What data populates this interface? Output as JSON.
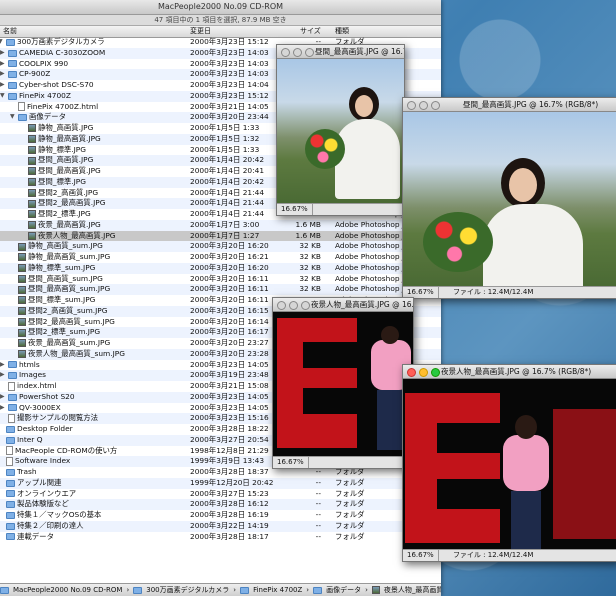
{
  "finder": {
    "title": "MacPeople2000 No.09 CD-ROM",
    "status": "47 項目中の 1 項目を選択, 87.9 MB 空き",
    "columns": {
      "name": "名前",
      "date": "変更日",
      "size": "サイズ",
      "kind": "種類"
    },
    "rows": [
      {
        "indent": 0,
        "icon": "folder",
        "tri": "▼",
        "name": "300万画素デジタルカメラ",
        "date": "2000年3月23日 15:12",
        "size": "--",
        "kind": "フォルダ"
      },
      {
        "indent": 1,
        "icon": "folder",
        "tri": "▶",
        "name": "CAMEDIA C-3030ZOOM",
        "date": "2000年3月23日 14:03",
        "size": "--",
        "kind": "フォルダ"
      },
      {
        "indent": 1,
        "icon": "folder",
        "tri": "▶",
        "name": "COOLPIX 990",
        "date": "2000年3月23日 14:03",
        "size": "--",
        "kind": "フォルダ"
      },
      {
        "indent": 1,
        "icon": "folder",
        "tri": "▶",
        "name": "CP-900Z",
        "date": "2000年3月23日 14:03",
        "size": "--",
        "kind": "フォルダ"
      },
      {
        "indent": 1,
        "icon": "folder",
        "tri": "▶",
        "name": "Cyber-shot DSC-S70",
        "date": "2000年3月23日 14:04",
        "size": "--",
        "kind": "フォルダ"
      },
      {
        "indent": 1,
        "icon": "folder",
        "tri": "▼",
        "name": "FinePix 4700Z",
        "date": "2000年3月23日 15:12",
        "size": "--",
        "kind": "フォルダ"
      },
      {
        "indent": 2,
        "icon": "file",
        "tri": "",
        "name": "FinePix 4700Z.html",
        "date": "2000年3月21日 14:05",
        "size": "",
        "kind": ""
      },
      {
        "indent": 2,
        "icon": "folder",
        "tri": "▼",
        "name": "画像データ",
        "date": "2000年3月20日 23:44",
        "size": "",
        "kind": ""
      },
      {
        "indent": 3,
        "icon": "image",
        "tri": "",
        "name": "静物_高画質.JPG",
        "date": "2000年1月5日 1:33",
        "size": "",
        "kind": ""
      },
      {
        "indent": 3,
        "icon": "image",
        "tri": "",
        "name": "静物_最高画質.JPG",
        "date": "2000年1月5日 1:32",
        "size": "",
        "kind": ""
      },
      {
        "indent": 3,
        "icon": "image",
        "tri": "",
        "name": "静物_標準.JPG",
        "date": "2000年1月5日 1:33",
        "size": "",
        "kind": ""
      },
      {
        "indent": 3,
        "icon": "image",
        "tri": "",
        "name": "昼間_高画質.JPG",
        "date": "2000年1月4日 20:42",
        "size": "",
        "kind": ""
      },
      {
        "indent": 3,
        "icon": "image",
        "tri": "",
        "name": "昼間_最高画質.JPG",
        "date": "2000年1月4日 20:41",
        "size": "",
        "kind": ""
      },
      {
        "indent": 3,
        "icon": "image",
        "tri": "",
        "name": "昼間_標準.JPG",
        "date": "2000年1月4日 20:42",
        "size": "",
        "kind": ""
      },
      {
        "indent": 3,
        "icon": "image",
        "tri": "",
        "name": "昼間2_高画質.JPG",
        "date": "2000年1月4日 21:44",
        "size": "",
        "kind": ""
      },
      {
        "indent": 3,
        "icon": "image",
        "tri": "",
        "name": "昼間2_最高画質.JPG",
        "date": "2000年1月4日 21:44",
        "size": "",
        "kind": ""
      },
      {
        "indent": 3,
        "icon": "image",
        "tri": "",
        "name": "昼間2_標準.JPG",
        "date": "2000年1月4日 21:44",
        "size": "355 KB",
        "kind": "Adobe Photoshop JPG"
      },
      {
        "indent": 3,
        "icon": "image",
        "tri": "",
        "name": "夜景_最高画質.JPG",
        "date": "2000年1月7日 3:00",
        "size": "1.6 MB",
        "kind": "Adobe Photoshop JPG"
      },
      {
        "indent": 3,
        "icon": "image",
        "tri": "",
        "name": "夜景人物_最高画質.JPG",
        "date": "2000年1月7日 1:27",
        "size": "1.6 MB",
        "kind": "Adobe Photoshop JPG",
        "selected": true
      },
      {
        "indent": 2,
        "icon": "image",
        "tri": "",
        "name": "静物_高画質_sum.JPG",
        "date": "2000年3月20日 16:20",
        "size": "32 KB",
        "kind": "Adobe Photoshop JPG"
      },
      {
        "indent": 2,
        "icon": "image",
        "tri": "",
        "name": "静物_最高画質_sum.JPG",
        "date": "2000年3月20日 16:21",
        "size": "32 KB",
        "kind": "Adobe Photoshop JPG"
      },
      {
        "indent": 2,
        "icon": "image",
        "tri": "",
        "name": "静物_標準_sum.JPG",
        "date": "2000年3月20日 16:20",
        "size": "32 KB",
        "kind": "Adobe Photoshop JPG"
      },
      {
        "indent": 2,
        "icon": "image",
        "tri": "",
        "name": "昼間_高画質_sum.JPG",
        "date": "2000年3月20日 16:11",
        "size": "32 KB",
        "kind": "Adobe Photoshop JPG"
      },
      {
        "indent": 2,
        "icon": "image",
        "tri": "",
        "name": "昼間_最高画質_sum.JPG",
        "date": "2000年3月20日 16:11",
        "size": "32 KB",
        "kind": "Adobe Photoshop JPG"
      },
      {
        "indent": 2,
        "icon": "image",
        "tri": "",
        "name": "昼間_標準_sum.JPG",
        "date": "2000年3月20日 16:11",
        "size": "32 KB",
        "kind": "Adobe Photoshop JPG"
      },
      {
        "indent": 2,
        "icon": "image",
        "tri": "",
        "name": "昼間2_高画質_sum.JPG",
        "date": "2000年3月20日 16:15",
        "size": "",
        "kind": ""
      },
      {
        "indent": 2,
        "icon": "image",
        "tri": "",
        "name": "昼間2_最高画質_sum.JPG",
        "date": "2000年3月20日 16:14",
        "size": "",
        "kind": ""
      },
      {
        "indent": 2,
        "icon": "image",
        "tri": "",
        "name": "昼間2_標準_sum.JPG",
        "date": "2000年3月20日 16:17",
        "size": "",
        "kind": ""
      },
      {
        "indent": 2,
        "icon": "image",
        "tri": "",
        "name": "夜景_最高画質_sum.JPG",
        "date": "2000年3月20日 23:27",
        "size": "",
        "kind": ""
      },
      {
        "indent": 2,
        "icon": "image",
        "tri": "",
        "name": "夜景人物_最高画質_sum.JPG",
        "date": "2000年3月20日 23:28",
        "size": "",
        "kind": ""
      },
      {
        "indent": 1,
        "icon": "folder",
        "tri": "▶",
        "name": "htmls",
        "date": "2000年3月23日 14:05",
        "size": "",
        "kind": ""
      },
      {
        "indent": 1,
        "icon": "folder",
        "tri": "▶",
        "name": "Images",
        "date": "2000年3月19日 23:48",
        "size": "",
        "kind": ""
      },
      {
        "indent": 1,
        "icon": "file",
        "tri": "",
        "name": "index.html",
        "date": "2000年3月21日 15:08",
        "size": "",
        "kind": ""
      },
      {
        "indent": 1,
        "icon": "folder",
        "tri": "▶",
        "name": "PowerShot S20",
        "date": "2000年3月23日 14:05",
        "size": "",
        "kind": ""
      },
      {
        "indent": 1,
        "icon": "folder",
        "tri": "▶",
        "name": "QV-3000EX",
        "date": "2000年3月23日 14:05",
        "size": "",
        "kind": ""
      },
      {
        "indent": 1,
        "icon": "file",
        "tri": "",
        "name": "撮影サンプルの閲覧方法",
        "date": "2000年3月23日 15:16",
        "size": "",
        "kind": ""
      },
      {
        "indent": 0,
        "icon": "folder",
        "tri": "",
        "name": "Desktop Folder",
        "date": "2000年3月28日 18:22",
        "size": "",
        "kind": ""
      },
      {
        "indent": 0,
        "icon": "folder",
        "tri": "",
        "name": "Inter Q",
        "date": "2000年3月27日 20:54",
        "size": "",
        "kind": ""
      },
      {
        "indent": 0,
        "icon": "file",
        "tri": "",
        "name": "MacPeople CD-ROMの使い方",
        "date": "1998年12月8日 21:29",
        "size": "",
        "kind": ""
      },
      {
        "indent": 0,
        "icon": "file",
        "tri": "",
        "name": "Software Index",
        "date": "1999年3月9日 13:43",
        "size": "",
        "kind": ""
      },
      {
        "indent": 0,
        "icon": "folder",
        "tri": "",
        "name": "Trash",
        "date": "2000年3月28日 18:37",
        "size": "--",
        "kind": "フォルダ"
      },
      {
        "indent": 0,
        "icon": "folder",
        "tri": "",
        "name": "アップル関連",
        "date": "1999年12月20日 20:42",
        "size": "--",
        "kind": "フォルダ"
      },
      {
        "indent": 0,
        "icon": "folder",
        "tri": "",
        "name": "オンラインウエア",
        "date": "2000年3月27日 15:23",
        "size": "--",
        "kind": "フォルダ"
      },
      {
        "indent": 0,
        "icon": "folder",
        "tri": "",
        "name": "製品体験版など",
        "date": "2000年3月28日 16:12",
        "size": "--",
        "kind": "フォルダ"
      },
      {
        "indent": 0,
        "icon": "folder",
        "tri": "",
        "name": "特集１／マックOSの基本",
        "date": "2000年3月28日 16:19",
        "size": "--",
        "kind": "フォルダ"
      },
      {
        "indent": 0,
        "icon": "folder",
        "tri": "",
        "name": "特集２／印刷の達人",
        "date": "2000年3月22日 14:19",
        "size": "--",
        "kind": "フォルダ"
      },
      {
        "indent": 0,
        "icon": "folder",
        "tri": "",
        "name": "連載データ",
        "date": "2000年3月28日 18:17",
        "size": "--",
        "kind": "フォルダ"
      }
    ],
    "path": [
      "MacPeople2000 No.09 CD-ROM",
      "300万画素デジタルカメラ",
      "FinePix 4700Z",
      "画像データ",
      "夜景人物_最高画質.JPG"
    ]
  },
  "windows": [
    {
      "title": "昼間_最高画質.JPG @ 16.7% (RGB/8*)",
      "zoom": "16.67%",
      "file": ""
    },
    {
      "title": "昼間_最高画質.JPG @ 16.7% (RGB/8*)",
      "zoom": "16.67%",
      "file": "ファイル : 12.4M/12.4M"
    },
    {
      "title": "夜景人物_最高画質.JPG @ 16.7% (RGB/8*)",
      "zoom": "16.67%",
      "file": ""
    },
    {
      "title": "夜景人物_最高画質.JPG @ 16.7% (RGB/8*)",
      "zoom": "16.67%",
      "file": "ファイル : 12.4M/12.4M"
    }
  ]
}
